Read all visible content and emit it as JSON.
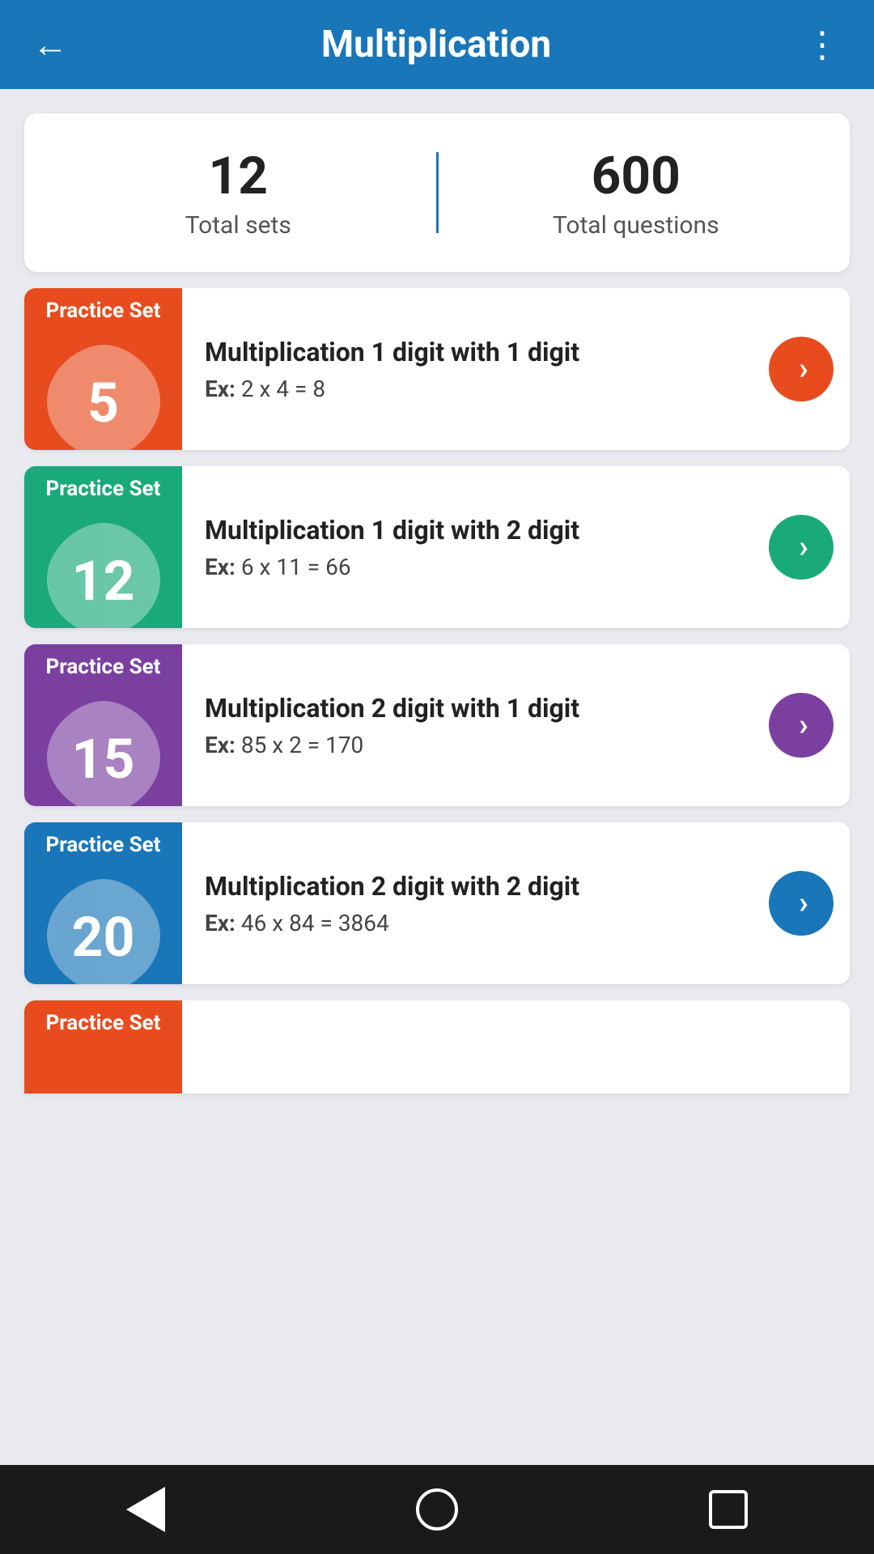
{
  "header": {
    "title": "Multiplication",
    "back_label": "←",
    "menu_label": "⋮"
  },
  "stats": {
    "total_sets": "12",
    "total_sets_label": "Total sets",
    "total_questions": "600",
    "total_questions_label": "Total questions"
  },
  "practice_sets": [
    {
      "id": 1,
      "badge_label": "Practice Set",
      "number": "5",
      "title": "Multiplication 1 digit with 1 digit",
      "example_prefix": "Ex:",
      "example": "2 x 4 = 8",
      "color": "orange",
      "bg": "#e84c1e",
      "arrow_color": "#e84c1e"
    },
    {
      "id": 2,
      "badge_label": "Practice Set",
      "number": "12",
      "title": "Multiplication 1 digit with 2 digit",
      "example_prefix": "Ex:",
      "example": "6 x 11 = 66",
      "color": "teal",
      "bg": "#1aaa7a",
      "arrow_color": "#1aaa7a"
    },
    {
      "id": 3,
      "badge_label": "Practice Set",
      "number": "15",
      "title": "Multiplication 2 digit with 1 digit",
      "example_prefix": "Ex:",
      "example": "85 x 2 = 170",
      "color": "purple",
      "bg": "#7b3fa0",
      "arrow_color": "#7b3fa0"
    },
    {
      "id": 4,
      "badge_label": "Practice Set",
      "number": "20",
      "title": "Multiplication 2 digit with 2 digit",
      "example_prefix": "Ex:",
      "example": "46 x 84 = 3864",
      "color": "blue",
      "bg": "#1976b8",
      "arrow_color": "#1976b8"
    }
  ],
  "partial_set": {
    "badge_label": "Practice Set",
    "bg": "#e84c1e"
  },
  "nav": {
    "back": "back",
    "home": "home",
    "recents": "recents"
  }
}
